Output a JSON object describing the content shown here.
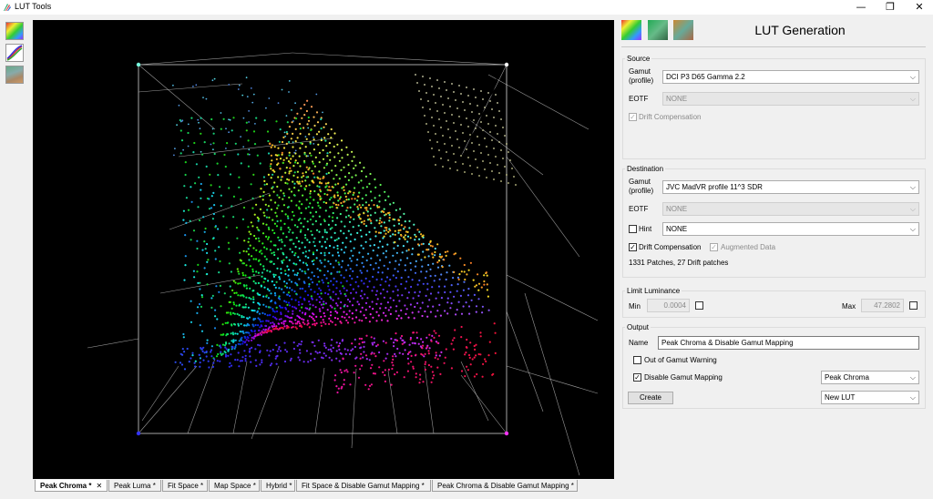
{
  "window": {
    "title": "LUT Tools",
    "minimize_glyph": "—",
    "restore_glyph": "❐",
    "close_glyph": "✕"
  },
  "left_toolbar": [
    {
      "icon": "gamut-cube-icon"
    },
    {
      "icon": "curve-graph-icon"
    },
    {
      "icon": "map-image-icon"
    }
  ],
  "tabs": [
    {
      "label": "Peak Chroma *",
      "active": true,
      "close": "✕"
    },
    {
      "label": "Peak Luma *",
      "active": false
    },
    {
      "label": "Fit Space *",
      "active": false
    },
    {
      "label": "Map Space *",
      "active": false
    },
    {
      "label": "Hybrid *",
      "active": false
    },
    {
      "label": "Fit Space & Disable Gamut Mapping *",
      "active": false
    },
    {
      "label": "Peak Chroma & Disable Gamut Mapping *",
      "active": false
    }
  ],
  "panel": {
    "title": "LUT Generation",
    "icons": [
      "cube-color-icon",
      "cube-green-icon",
      "cube-orange-icon"
    ],
    "source": {
      "label": "Source",
      "gamut_label_1": "Gamut",
      "gamut_label_2": "(profile)",
      "gamut_value": "DCI P3 D65 Gamma 2.2",
      "eotf_label": "EOTF",
      "eotf_value": "NONE",
      "drift_label": "Drift Compensation",
      "drift_checked": true
    },
    "destination": {
      "label": "Destination",
      "gamut_label_1": "Gamut",
      "gamut_label_2": "(profile)",
      "gamut_value": "JVC MadVR profile 11^3 SDR",
      "eotf_label": "EOTF",
      "eotf_value": "NONE",
      "hint_label": "Hint",
      "hint_value": "NONE",
      "drift_label": "Drift Compensation",
      "augmented_label": "Augmented Data",
      "patches_text": "1331 Patches, 27 Drift patches"
    },
    "limit": {
      "label": "Limit Luminance",
      "min_label": "Min",
      "min_value": "0.0004",
      "max_label": "Max",
      "max_value": "47.2802"
    },
    "output": {
      "label": "Output",
      "name_label": "Name",
      "name_value": "Peak Chroma & Disable Gamut Mapping",
      "oog_label": "Out of Gamut Warning",
      "disable_label": "Disable Gamut Mapping",
      "mapping_value": "Peak Chroma",
      "create_label": "Create",
      "lut_value": "New LUT"
    }
  }
}
